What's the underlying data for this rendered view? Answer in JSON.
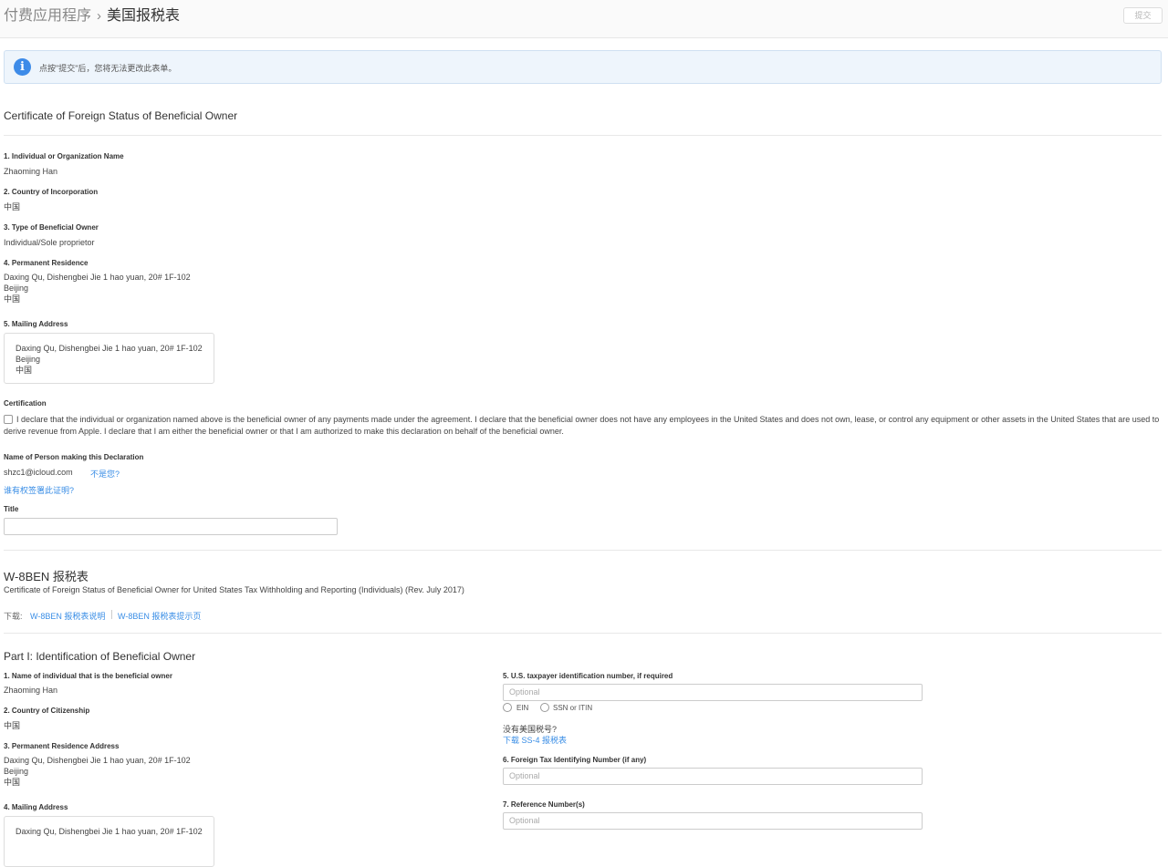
{
  "header": {
    "breadcrumb_parent": "付费应用程序",
    "breadcrumb_sep": "›",
    "breadcrumb_current": "美国报税表",
    "submit_label": "提交"
  },
  "notice": {
    "icon": "info-icon",
    "text": "点按\"提交\"后，您将无法更改此表单。"
  },
  "certificate": {
    "title": "Certificate of Foreign Status of Beneficial Owner",
    "fields": [
      {
        "label": "1. Individual or Organization Name",
        "value": "Zhaoming Han"
      },
      {
        "label": "2. Country of Incorporation",
        "value": "中国"
      },
      {
        "label": "3. Type of Beneficial Owner",
        "value": "Individual/Sole proprietor"
      },
      {
        "label": "4. Permanent Residence",
        "lines": [
          "Daxing Qu, Dishengbei Jie 1 hao yuan, 20# 1F-102",
          "Beijing",
          "中国"
        ]
      }
    ],
    "mailing": {
      "label": "5. Mailing Address",
      "lines": [
        "Daxing Qu, Dishengbei Jie 1 hao yuan, 20# 1F-102",
        "Beijing",
        "中国"
      ]
    },
    "certification": {
      "label": "Certification",
      "text": "I declare that the individual or organization named above is the beneficial owner of any payments made under the agreement. I declare that the beneficial owner does not have any employees in the United States and does not own, lease, or control any equipment or other assets in the United States that are used to derive revenue from Apple. I declare that I am either the beneficial owner or that I am authorized to make this declaration on behalf of the beneficial owner.",
      "checked": false
    },
    "declarant": {
      "label": "Name of Person making this Declaration",
      "email": "shzc1@icloud.com",
      "not_you_link": "不是您?",
      "who_link": "谁有权签署此证明?"
    },
    "title_field": {
      "label": "Title",
      "value": ""
    }
  },
  "w8ben": {
    "title": "W-8BEN 报税表",
    "subtitle": "Certificate of Foreign Status of Beneficial Owner for United States Tax Withholding and Reporting (Individuals) (Rev. July 2017)",
    "download_label": "下载:",
    "download_links": [
      "W-8BEN 报税表说明",
      "W-8BEN 报税表提示页"
    ]
  },
  "part1": {
    "title": "Part I: Identification of Beneficial Owner",
    "left": {
      "name": {
        "label": "1. Name of individual that is the beneficial owner",
        "value": "Zhaoming Han"
      },
      "citizenship": {
        "label": "2. Country of Citizenship",
        "value": "中国"
      },
      "residence": {
        "label": "3. Permanent Residence Address",
        "lines": [
          "Daxing Qu, Dishengbei Jie 1 hao yuan, 20# 1F-102",
          "Beijing",
          "中国"
        ]
      },
      "mailing": {
        "label": "4. Mailing Address",
        "lines": [
          "Daxing Qu, Dishengbei Jie 1 hao yuan, 20# 1F-102"
        ]
      }
    },
    "right": {
      "tin": {
        "label": "5. U.S. taxpayer identification number, if required",
        "placeholder": "Optional",
        "options": [
          "EIN",
          "SSN or ITIN"
        ],
        "no_tin_text": "没有美国税号?",
        "ss4_link": "下载 SS-4 报税表"
      },
      "foreign_tin": {
        "label": "6. Foreign Tax Identifying Number (if any)",
        "placeholder": "Optional"
      },
      "reference": {
        "label": "7. Reference Number(s)",
        "placeholder": "Optional"
      }
    }
  }
}
